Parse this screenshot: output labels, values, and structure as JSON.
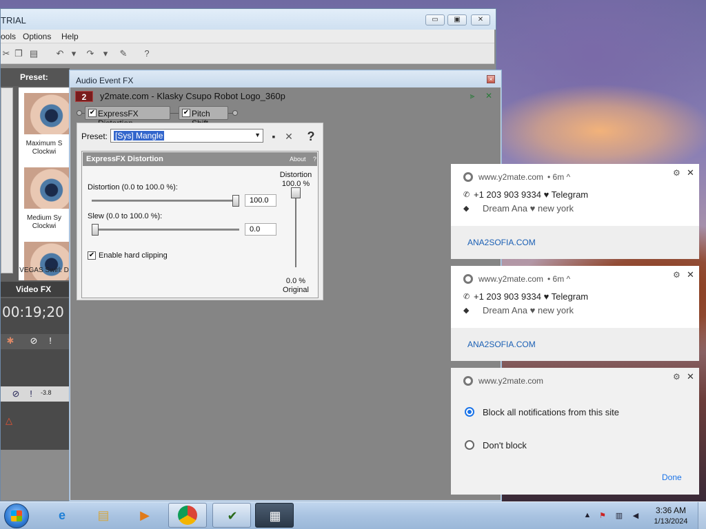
{
  "vegas": {
    "title": "TRIAL",
    "menu": [
      "ools",
      "Options",
      "Help"
    ],
    "left_panel": {
      "preset_label": "Preset:",
      "thumbs": [
        "Maximum S\nClockwi",
        "Medium Sy\nClockwi",
        "VEGAS Swirl: D"
      ],
      "video_fx_tab": "Video FX",
      "timecode": "00:19;20",
      "volume_readout": "-3.8"
    }
  },
  "fx_dialog": {
    "title": "Audio Event FX",
    "event_number": "2",
    "event_name": "y2mate.com - Klasky Csupo Robot Logo_360p",
    "chain": [
      {
        "label": "ExpressFX Distortion",
        "checked": true
      },
      {
        "label": "Pitch Shift",
        "checked": true
      }
    ],
    "preset_label": "Preset:",
    "preset_value": "[Sys] Mangle",
    "help_symbol": "?",
    "plugin": {
      "name": "ExpressFX Distortion",
      "about": "About",
      "help": "?",
      "distortion_label": "Distortion (0.0 to 100.0 %):",
      "distortion_value": "100.0",
      "slew_label": "Slew (0.0 to 100.0 %):",
      "slew_value": "0.0",
      "hard_clipping_label": "Enable hard clipping",
      "hard_clipping_checked": true,
      "vslider_top_label_1": "Distortion",
      "vslider_top_label_2": "100.0 %",
      "vslider_bottom_label_1": "0.0 %",
      "vslider_bottom_label_2": "Original",
      "distortion_level": 1.0,
      "slew_level": 0.0,
      "vertical_level": 1.0
    }
  },
  "notifications": [
    {
      "site": "www.y2mate.com",
      "age": "• 6m ^",
      "line1": "+1 203 903 9334 ♥ Telegram",
      "line2": "Dream Ana ♥ new york",
      "link": "ANA2SOFIA.COM"
    },
    {
      "site": "www.y2mate.com",
      "age": "• 6m ^",
      "line1": "+1 203 903 9334 ♥ Telegram",
      "line2": "Dream Ana ♥ new york",
      "link": "ANA2SOFIA.COM"
    }
  ],
  "permission_notification": {
    "site": "www.y2mate.com",
    "option_block": "Block all notifications from this site",
    "option_dont_block": "Don't block",
    "selected": "block",
    "done": "Done"
  },
  "taskbar": {
    "time": "3:36 AM",
    "date": "1/13/2024",
    "apps": [
      "ie-icon",
      "explorer-icon",
      "media-player-icon",
      "chrome-icon",
      "vegas-icon",
      "film-icon"
    ]
  }
}
